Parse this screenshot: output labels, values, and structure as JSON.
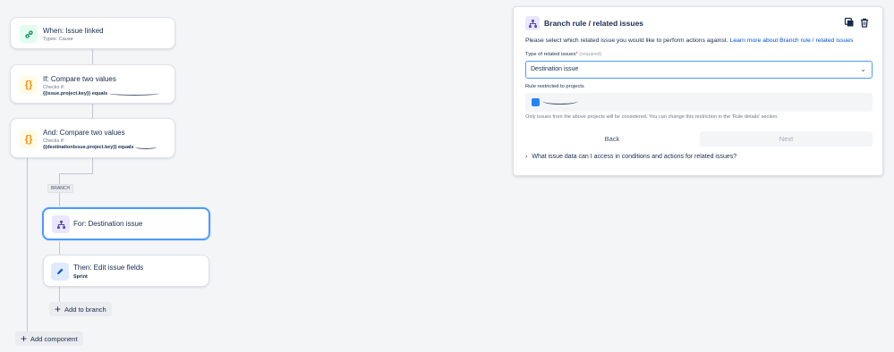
{
  "flow": {
    "trigger": {
      "title": "When: Issue linked",
      "sub": "Types: Cause"
    },
    "cond1": {
      "title": "If: Compare two values",
      "checks": "Checks if:",
      "expr": "{{issue.project.key}} equals"
    },
    "cond2": {
      "title": "And: Compare two values",
      "checks": "Checks if:",
      "expr": "{{destinationIssue.project.key}} equals"
    },
    "branch_tag": "BRANCH",
    "branch": {
      "title": "For: Destination issue"
    },
    "action": {
      "title": "Then: Edit issue fields",
      "sub": "Sprint"
    },
    "add_to_branch": "Add to branch",
    "add_component": "Add component"
  },
  "panel": {
    "title": "Branch rule / related issues",
    "desc_text": "Please select which related issue you would like to perform actions against.",
    "desc_link": "Learn more about Branch rule / related issues",
    "type_label": "Type of related issues",
    "type_required_mark": "*",
    "type_required_hint": "(required)",
    "type_value": "Destination issue",
    "restricted_label": "Rule restricted to projects",
    "note": "Only issues from the above projects will be considered. You can change this restriction in the 'Rule details' section.",
    "back_label": "Back",
    "next_label": "Next",
    "expander_label": "What issue data can I access in conditions and actions for related issues?"
  },
  "colors": {
    "trigger_icon_bg": "#e3fcef",
    "trigger_icon_fg": "#00875a",
    "condition_icon_bg": "#fffae6",
    "condition_icon_fg": "#ff8b00",
    "branch_icon_bg": "#eae6ff",
    "branch_icon_fg": "#5243aa",
    "action_icon_bg": "#deebff",
    "action_icon_fg": "#0052cc",
    "selected_border": "#4c9aff",
    "link": "#0052cc"
  },
  "icons": {
    "trigger": "link-icon",
    "condition": "curly-braces-icon",
    "branch": "branch-icon",
    "action": "pencil-icon",
    "copy": "copy-icon",
    "delete": "trash-icon",
    "dropdown": "chevron-down-icon",
    "expander": "chevron-right-icon"
  }
}
